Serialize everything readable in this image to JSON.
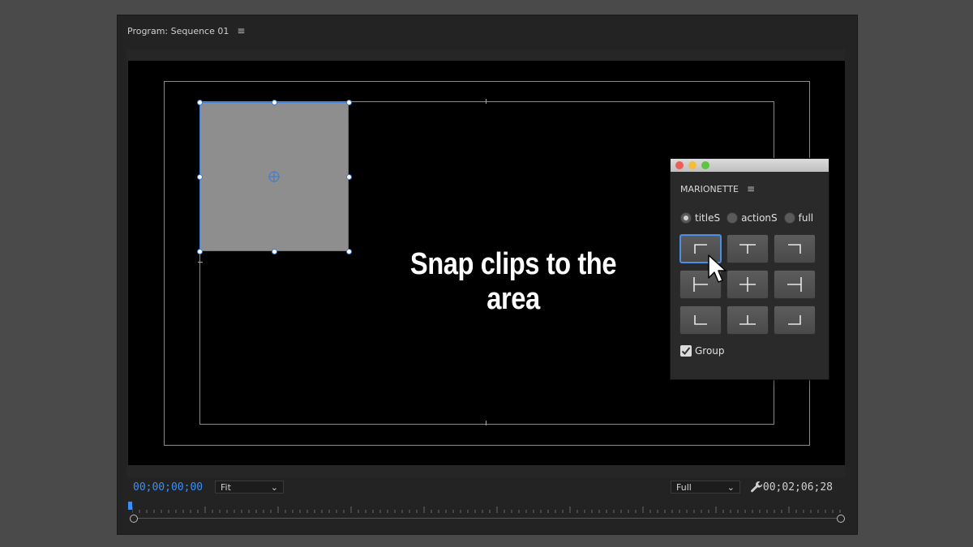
{
  "panel": {
    "title": "Program: Sequence 01"
  },
  "overlay": {
    "caption": "Snap clips to the area"
  },
  "marionette": {
    "title": "MARIONETTE",
    "radio_options": [
      {
        "label": "titleS",
        "selected": true
      },
      {
        "label": "actionS",
        "selected": false
      },
      {
        "label": "full",
        "selected": false
      }
    ],
    "snap_buttons": [
      "top-left",
      "top-center",
      "top-right",
      "middle-left",
      "center",
      "middle-right",
      "bottom-left",
      "bottom-center",
      "bottom-right"
    ],
    "active_snap": "top-left",
    "group_label": "Group",
    "group_checked": true
  },
  "controls": {
    "current_time": "00;00;00;00",
    "zoom_select": "Fit",
    "resolution_select": "Full",
    "duration": "00;02;06;28"
  },
  "colors": {
    "accent": "#3a8ef6",
    "clip_fill": "#8e8e8e",
    "active_border": "#4d8fe8"
  }
}
